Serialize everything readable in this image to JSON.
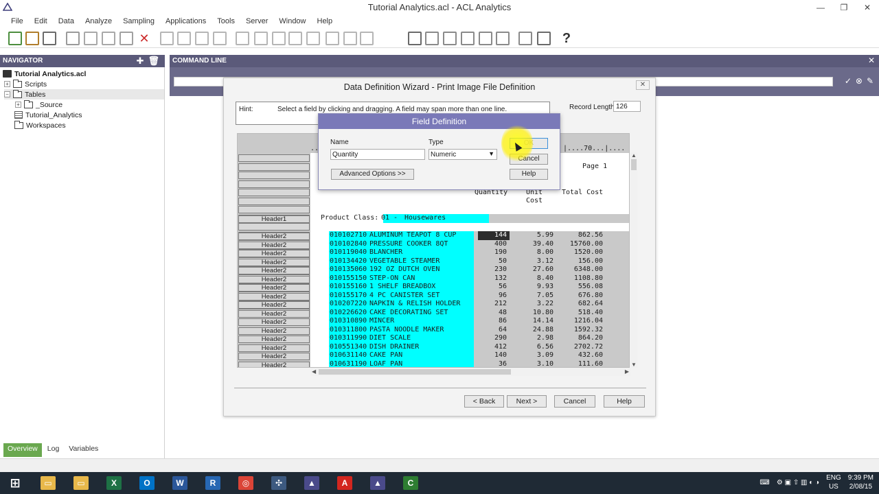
{
  "window": {
    "title": "Tutorial Analytics.acl - ACL Analytics"
  },
  "menu": [
    "File",
    "Edit",
    "Data",
    "Analyze",
    "Sampling",
    "Applications",
    "Tools",
    "Server",
    "Window",
    "Help"
  ],
  "toolbar": {
    "icons": [
      "open-project-icon",
      "open-table-icon",
      "save-icon",
      "cut-icon",
      "copy-icon",
      "paste-icon",
      "undo-icon",
      "delete-icon",
      "filter-icon",
      "edit-view-icon",
      "sort-icon",
      "index-icon",
      "join-icon",
      "relate-icon",
      "merge-icon",
      "summarize-icon",
      "classify-icon",
      "stratify-icon",
      "age-icon",
      "statistics-icon",
      "new-table-icon",
      "edit-icon",
      "report-icon",
      "text-icon",
      "field-icon",
      "print-icon",
      "print-preview-icon",
      "command-icon",
      "help-icon"
    ]
  },
  "navigator": {
    "title": "NAVIGATOR",
    "project": "Tutorial Analytics.acl",
    "items": [
      {
        "label": "Scripts",
        "level": 1,
        "type": "folder",
        "expander": "+"
      },
      {
        "label": "Tables",
        "level": 1,
        "type": "folder",
        "expander": "−"
      },
      {
        "label": "_Source",
        "level": 2,
        "type": "folder",
        "expander": "+"
      },
      {
        "label": "Tutorial_Analytics",
        "level": 1,
        "type": "table",
        "expander": ""
      },
      {
        "label": "Workspaces",
        "level": 1,
        "type": "folder",
        "expander": ""
      }
    ]
  },
  "command_line": {
    "title": "COMMAND LINE"
  },
  "bottom_tabs": [
    "Overview",
    "Log",
    "Variables"
  ],
  "wizard": {
    "title": "Data Definition Wizard - Print Image File Definition",
    "hint_label": "Hint:",
    "hint_text": "Select a field by clicking and dragging. A field may span more than one line.",
    "record_length_label": "Record Length",
    "record_length": "126",
    "ruler_right": "|....70...|....",
    "ruler_left": "..",
    "page_text": "Page 1",
    "col_quantity": "Quantity",
    "col_unit_1": "Unit",
    "col_unit_2": "Cost",
    "col_total": "Total Cost",
    "header1_label": "Header1",
    "product_class_prefix": "Product Class:",
    "product_class_code": "01 -",
    "product_class_name": "Housewares",
    "rows": [
      {
        "label": "Header2",
        "code": "010102710",
        "desc": "ALUMINUM TEAPOT 8 CUP",
        "qty": "144",
        "unit": "5.99",
        "total": "862.56"
      },
      {
        "label": "Header2",
        "code": "010102840",
        "desc": "PRESSURE COOKER 8QT",
        "qty": "400",
        "unit": "39.40",
        "total": "15760.00"
      },
      {
        "label": "Header2",
        "code": "010119040",
        "desc": "BLANCHER",
        "qty": "190",
        "unit": "8.00",
        "total": "1520.00"
      },
      {
        "label": "Header2",
        "code": "010134420",
        "desc": "VEGETABLE STEAMER",
        "qty": "50",
        "unit": "3.12",
        "total": "156.00"
      },
      {
        "label": "Header2",
        "code": "010135060",
        "desc": "192 OZ DUTCH OVEN",
        "qty": "230",
        "unit": "27.60",
        "total": "6348.00"
      },
      {
        "label": "Header2",
        "code": "010155150",
        "desc": "STEP-ON CAN",
        "qty": "132",
        "unit": "8.40",
        "total": "1108.80"
      },
      {
        "label": "Header2",
        "code": "010155160",
        "desc": "1 SHELF BREADBOX",
        "qty": "56",
        "unit": "9.93",
        "total": "556.08"
      },
      {
        "label": "Header2",
        "code": "010155170",
        "desc": "4 PC CANISTER SET",
        "qty": "96",
        "unit": "7.05",
        "total": "676.80"
      },
      {
        "label": "Header2",
        "code": "010207220",
        "desc": "NAPKIN & RELISH HOLDER",
        "qty": "212",
        "unit": "3.22",
        "total": "682.64"
      },
      {
        "label": "Header2",
        "code": "010226620",
        "desc": "CAKE DECORATING SET",
        "qty": "48",
        "unit": "10.80",
        "total": "518.40"
      },
      {
        "label": "Header2",
        "code": "010310890",
        "desc": "MINCER",
        "qty": "86",
        "unit": "14.14",
        "total": "1216.04"
      },
      {
        "label": "Header2",
        "code": "010311800",
        "desc": "PASTA NOODLE MAKER",
        "qty": "64",
        "unit": "24.88",
        "total": "1592.32"
      },
      {
        "label": "Header2",
        "code": "010311990",
        "desc": "DIET SCALE",
        "qty": "290",
        "unit": "2.98",
        "total": "864.20"
      },
      {
        "label": "Header2",
        "code": "010551340",
        "desc": "DISH DRAINER",
        "qty": "412",
        "unit": "6.56",
        "total": "2702.72"
      },
      {
        "label": "Header2",
        "code": "010631140",
        "desc": "CAKE PAN",
        "qty": "140",
        "unit": "3.09",
        "total": "432.60"
      },
      {
        "label": "Header2",
        "code": "010631190",
        "desc": "LOAF PAN",
        "qty": "36",
        "unit": "3.10",
        "total": "111.60"
      }
    ],
    "buttons": {
      "back": "< Back",
      "next": "Next >",
      "cancel": "Cancel",
      "help": "Help"
    }
  },
  "field_definition": {
    "title": "Field Definition",
    "name_label": "Name",
    "name_value": "Quantity",
    "type_label": "Type",
    "type_value": "Numeric",
    "ok": "OK",
    "cancel": "Cancel",
    "advanced": "Advanced Options >>",
    "help": "Help"
  },
  "taskbar": {
    "apps": [
      "windows-start-icon",
      "file-explorer-icon",
      "file-explorer-icon",
      "excel-icon",
      "outlook-icon",
      "word-icon",
      "r-icon",
      "chrome-icon",
      "tableau-icon",
      "acl-icon",
      "acrobat-icon",
      "acl-icon",
      "camtasia-icon"
    ],
    "lang": "ENG",
    "region": "US",
    "time": "9:39 PM",
    "date": "2/08/15"
  }
}
